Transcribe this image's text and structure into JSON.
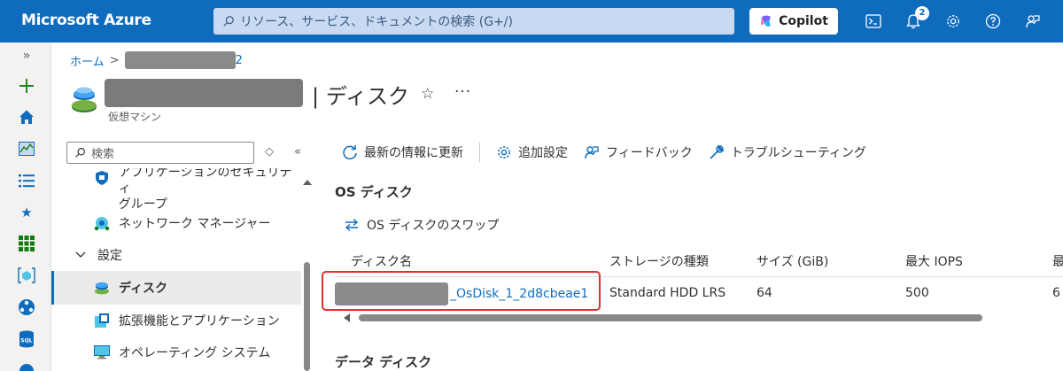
{
  "app": {
    "brand": "Microsoft Azure",
    "search_placeholder": "リソース、サービス、ドキュメントの検索 (G+/)",
    "copilot_label": "Copilot",
    "notification_count": "2"
  },
  "rail": {
    "expand_label": "»"
  },
  "breadcrumb": {
    "home": "ホーム",
    "current_suffix": "2"
  },
  "header": {
    "title": "| ディスク",
    "subtitle": "仮想マシン",
    "more_label": "···"
  },
  "menu": {
    "search_placeholder": "検索",
    "items": [
      {
        "label": "アプリケーションのセキュリティ",
        "label2": "グループ",
        "icon": "shield-icon"
      },
      {
        "label": "ネットワーク マネージャー",
        "icon": "network-manager-icon"
      },
      {
        "label": "設定",
        "icon": "chevron-down-icon"
      },
      {
        "label": "ディスク",
        "icon": "disk-icon"
      },
      {
        "label": "拡張機能とアプリケーション",
        "icon": "extensions-icon"
      },
      {
        "label": "オペレーティング システム",
        "icon": "monitor-icon"
      }
    ]
  },
  "toolbar": {
    "refresh": "最新の情報に更新",
    "settings": "追加設定",
    "feedback": "フィードバック",
    "troubleshoot": "トラブルシューティング"
  },
  "os_disk": {
    "section_title": "OS ディスク",
    "swap_label": "OS ディスクのスワップ",
    "columns": [
      "ディスク名",
      "ストレージの種類",
      "サイズ (GiB)",
      "最大 IOPS",
      "最"
    ],
    "row": {
      "name_suffix": "_OsDisk_1_2d8cbeae1",
      "storage_type": "Standard HDD LRS",
      "size": "64",
      "max_iops": "500",
      "truncated": "6"
    }
  },
  "data_disk": {
    "section_title": "データ ディスク"
  },
  "colors": {
    "accent": "#0f6cbd",
    "highlight": "#e03030"
  }
}
